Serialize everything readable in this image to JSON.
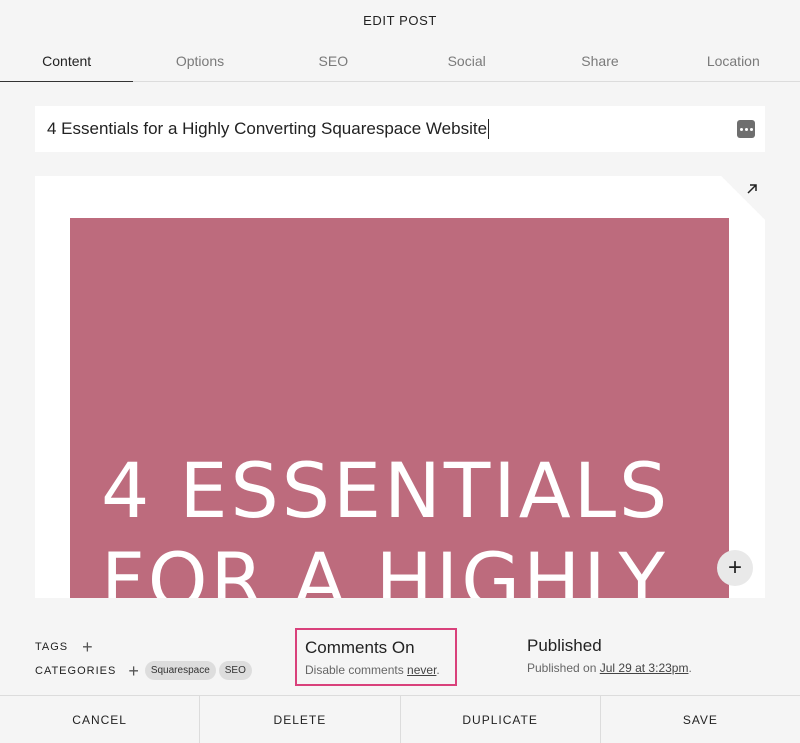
{
  "header": {
    "title": "EDIT POST"
  },
  "tabs": [
    {
      "label": "Content",
      "active": true
    },
    {
      "label": "Options",
      "active": false
    },
    {
      "label": "SEO",
      "active": false
    },
    {
      "label": "Social",
      "active": false
    },
    {
      "label": "Share",
      "active": false
    },
    {
      "label": "Location",
      "active": false
    }
  ],
  "post": {
    "title": "4 Essentials for a Highly Converting Squarespace Website"
  },
  "editor": {
    "image_text_line1": "4 ESSENTIALS",
    "image_text_line2": "FOR A HIGHLY",
    "image_color": "#bd6b7d",
    "icons": {
      "expand": "expand-arrow-icon",
      "add": "plus-icon",
      "more": "more-icon"
    }
  },
  "meta": {
    "tags_label": "TAGS",
    "categories_label": "CATEGORIES",
    "categories": [
      "Squarespace",
      "SEO"
    ]
  },
  "comments": {
    "title": "Comments On",
    "sub_prefix": "Disable comments ",
    "sub_link": "never",
    "sub_suffix": ".",
    "highlight_color": "#d9417b"
  },
  "published": {
    "title": "Published",
    "sub_prefix": "Published on ",
    "sub_link": "Jul 29 at 3:23pm",
    "sub_suffix": "."
  },
  "footer": {
    "cancel": "CANCEL",
    "delete": "DELETE",
    "duplicate": "DUPLICATE",
    "save": "SAVE"
  }
}
